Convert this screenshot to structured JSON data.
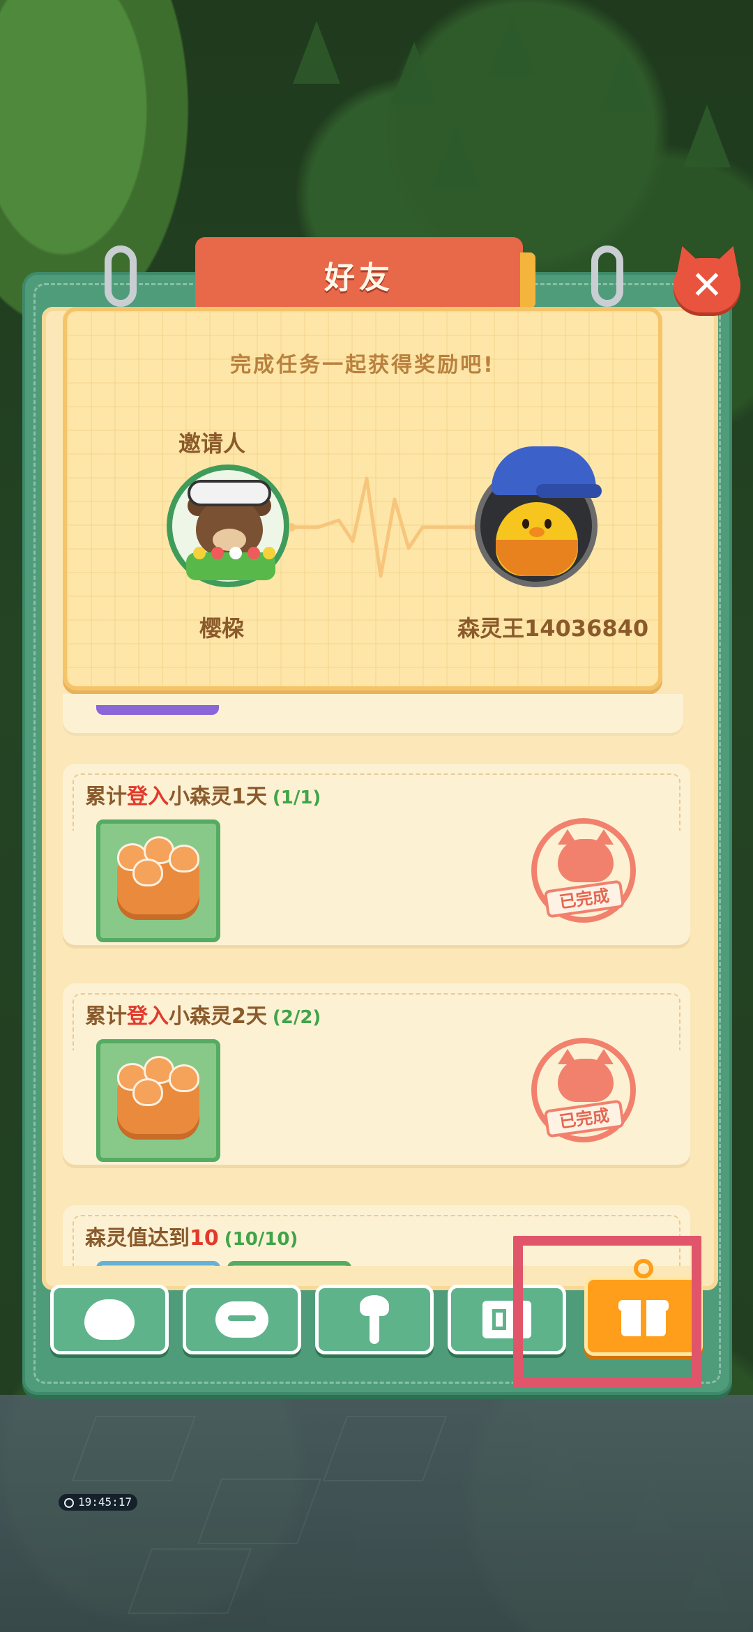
{
  "dialog": {
    "title": "好友",
    "close_symbol": "✕",
    "close_icon": "cat-close-icon"
  },
  "invite_card": {
    "message": "完成任务一起获得奖励吧!",
    "inviter_label": "邀请人",
    "inviter_name": "樱桗",
    "friend_name": "森灵王14036840"
  },
  "tasks": [
    {
      "title_prefix": "累计",
      "title_highlight": "登入",
      "title_suffix": "小森灵1天",
      "progress": "(1/1)",
      "reward_icon": "kitten-basket-icon",
      "status": "已完成"
    },
    {
      "title_prefix": "累计",
      "title_highlight": "登入",
      "title_suffix": "小森灵2天",
      "progress": "(2/2)",
      "reward_icon": "kitten-basket-icon",
      "status": "已完成"
    },
    {
      "title_prefix": "森灵值达到",
      "title_highlight": "10",
      "title_suffix": "",
      "progress": "(10/10)"
    }
  ],
  "tabs": [
    {
      "icon": "chick-icon",
      "active": false
    },
    {
      "icon": "chat-icon",
      "active": false
    },
    {
      "icon": "wrench-icon",
      "active": false
    },
    {
      "icon": "book-icon",
      "active": false
    },
    {
      "icon": "gift-icon",
      "active": true
    }
  ],
  "world": {
    "timer": "19:45:17"
  },
  "colors": {
    "panel_green": "#4f9c7a",
    "title_red": "#e8684a",
    "highlight_red": "#e13a2c",
    "progress_green": "#3fa44a",
    "active_tab_orange": "#ff9e1a",
    "annotation_box": "#e0556a"
  }
}
